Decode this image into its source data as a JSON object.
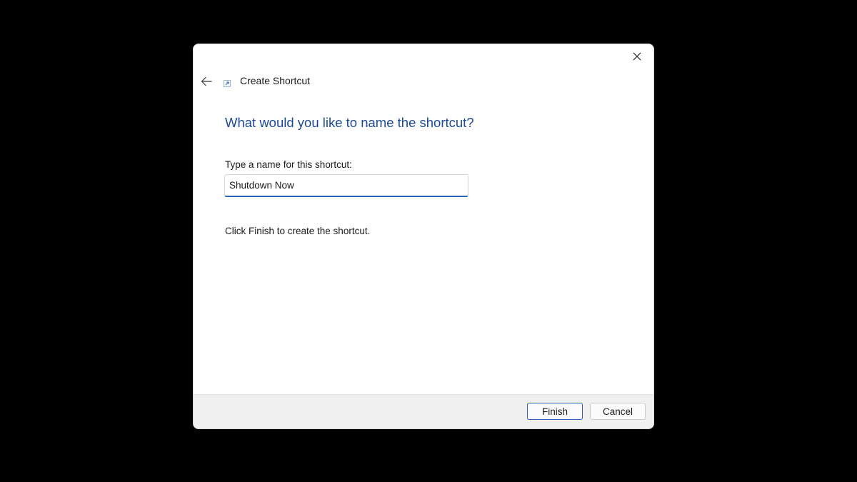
{
  "wizard": {
    "title": "Create Shortcut"
  },
  "page": {
    "heading": "What would you like to name the shortcut?",
    "field_label": "Type a name for this shortcut:",
    "name_value": "Shutdown Now",
    "instruction": "Click Finish to create the shortcut."
  },
  "footer": {
    "finish_label": "Finish",
    "cancel_label": "Cancel"
  },
  "colors": {
    "heading": "#1c4a97",
    "accent": "#2a62b8",
    "backdrop": "#000000",
    "footer_bg": "#f0f0f0"
  },
  "icons": {
    "close": "close-icon",
    "back": "back-arrow-icon",
    "wizard": "shortcut-icon"
  }
}
